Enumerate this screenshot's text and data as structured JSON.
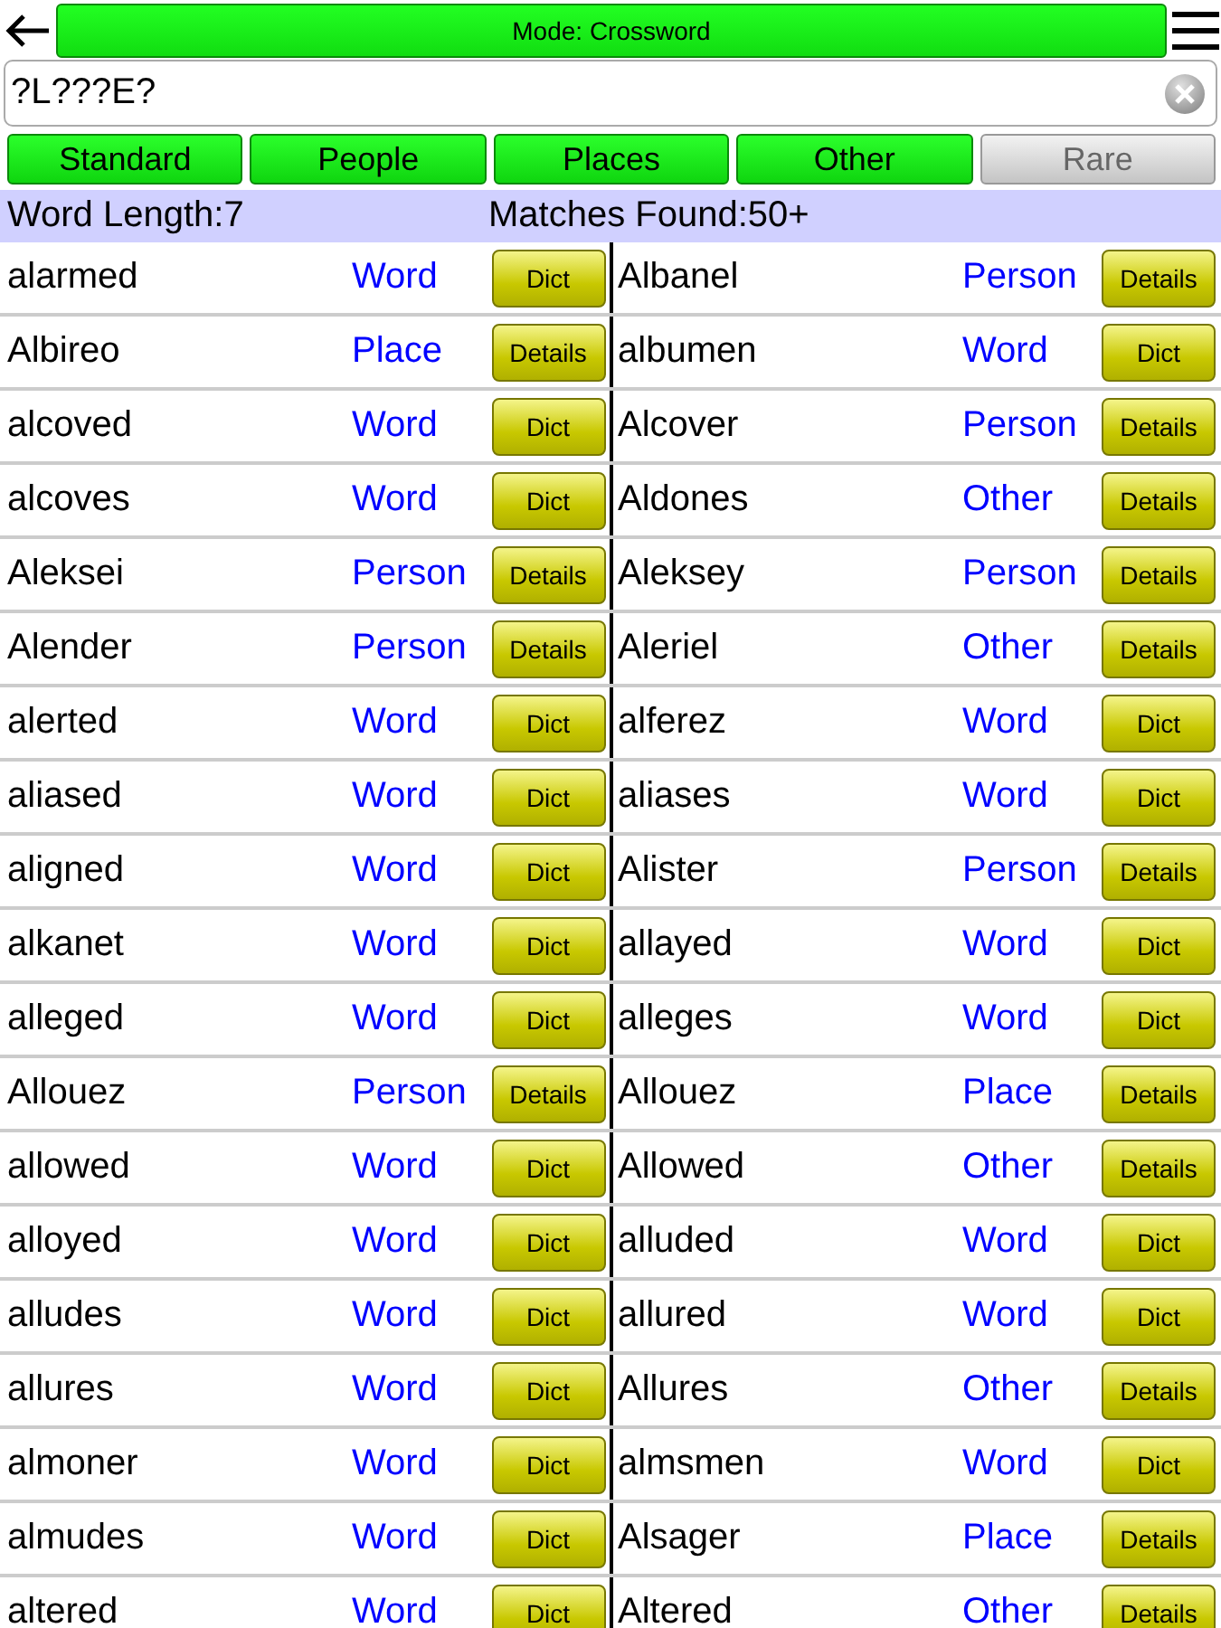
{
  "mode_bar": {
    "label": "Mode: Crossword"
  },
  "search": {
    "value": "?L???E?"
  },
  "filters": [
    {
      "label": "Standard",
      "on": true
    },
    {
      "label": "People",
      "on": true
    },
    {
      "label": "Places",
      "on": true
    },
    {
      "label": "Other",
      "on": true
    },
    {
      "label": "Rare",
      "on": false
    }
  ],
  "info": {
    "word_length": "Word Length:7",
    "matches": "Matches Found:50+"
  },
  "rows": [
    {
      "left": {
        "word": "alarmed",
        "type": "Word",
        "button": "Dict"
      },
      "right": {
        "word": "Albanel",
        "type": "Person",
        "button": "Details"
      }
    },
    {
      "left": {
        "word": "Albireo",
        "type": "Place",
        "button": "Details"
      },
      "right": {
        "word": "albumen",
        "type": "Word",
        "button": "Dict"
      }
    },
    {
      "left": {
        "word": "alcoved",
        "type": "Word",
        "button": "Dict"
      },
      "right": {
        "word": "Alcover",
        "type": "Person",
        "button": "Details"
      }
    },
    {
      "left": {
        "word": "alcoves",
        "type": "Word",
        "button": "Dict"
      },
      "right": {
        "word": "Aldones",
        "type": "Other",
        "button": "Details"
      }
    },
    {
      "left": {
        "word": "Aleksei",
        "type": "Person",
        "button": "Details"
      },
      "right": {
        "word": "Aleksey",
        "type": "Person",
        "button": "Details"
      }
    },
    {
      "left": {
        "word": "Alender",
        "type": "Person",
        "button": "Details"
      },
      "right": {
        "word": "Aleriel",
        "type": "Other",
        "button": "Details"
      }
    },
    {
      "left": {
        "word": "alerted",
        "type": "Word",
        "button": "Dict"
      },
      "right": {
        "word": "alferez",
        "type": "Word",
        "button": "Dict"
      }
    },
    {
      "left": {
        "word": "aliased",
        "type": "Word",
        "button": "Dict"
      },
      "right": {
        "word": "aliases",
        "type": "Word",
        "button": "Dict"
      }
    },
    {
      "left": {
        "word": "aligned",
        "type": "Word",
        "button": "Dict"
      },
      "right": {
        "word": "Alister",
        "type": "Person",
        "button": "Details"
      }
    },
    {
      "left": {
        "word": "alkanet",
        "type": "Word",
        "button": "Dict"
      },
      "right": {
        "word": "allayed",
        "type": "Word",
        "button": "Dict"
      }
    },
    {
      "left": {
        "word": "alleged",
        "type": "Word",
        "button": "Dict"
      },
      "right": {
        "word": "alleges",
        "type": "Word",
        "button": "Dict"
      }
    },
    {
      "left": {
        "word": "Allouez",
        "type": "Person",
        "button": "Details"
      },
      "right": {
        "word": "Allouez",
        "type": "Place",
        "button": "Details"
      }
    },
    {
      "left": {
        "word": "allowed",
        "type": "Word",
        "button": "Dict"
      },
      "right": {
        "word": "Allowed",
        "type": "Other",
        "button": "Details"
      }
    },
    {
      "left": {
        "word": "alloyed",
        "type": "Word",
        "button": "Dict"
      },
      "right": {
        "word": "alluded",
        "type": "Word",
        "button": "Dict"
      }
    },
    {
      "left": {
        "word": "alludes",
        "type": "Word",
        "button": "Dict"
      },
      "right": {
        "word": "allured",
        "type": "Word",
        "button": "Dict"
      }
    },
    {
      "left": {
        "word": "allures",
        "type": "Word",
        "button": "Dict"
      },
      "right": {
        "word": "Allures",
        "type": "Other",
        "button": "Details"
      }
    },
    {
      "left": {
        "word": "almoner",
        "type": "Word",
        "button": "Dict"
      },
      "right": {
        "word": "almsmen",
        "type": "Word",
        "button": "Dict"
      }
    },
    {
      "left": {
        "word": "almudes",
        "type": "Word",
        "button": "Dict"
      },
      "right": {
        "word": "Alsager",
        "type": "Place",
        "button": "Details"
      }
    },
    {
      "left": {
        "word": "altered",
        "type": "Word",
        "button": "Dict"
      },
      "right": {
        "word": "Altered",
        "type": "Other",
        "button": "Details"
      }
    }
  ]
}
